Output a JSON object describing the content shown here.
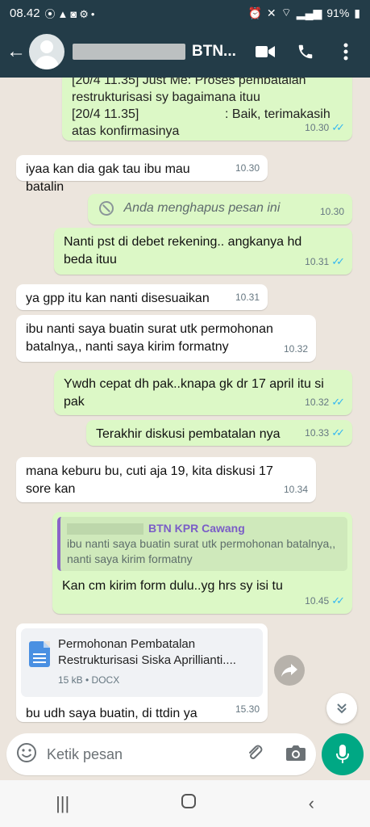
{
  "status_bar": {
    "time": "08.42",
    "battery": "91%"
  },
  "header": {
    "contact_suffix": "BTN...",
    "icons": [
      "back-arrow-icon",
      "avatar",
      "video-call-icon",
      "phone-icon",
      "more-vert-icon"
    ]
  },
  "messages": [
    {
      "dir": "out",
      "text": "[20/4 11.35] Just Me: Proses pembatalan restrukturisasi sy bagaimana ituu\n[20/4 11.35]                        : Baik, terimakasih atas konfirmasinya",
      "time": "10.30",
      "ticks": true
    },
    {
      "dir": "in",
      "text": "iyaa kan dia gak tau ibu mau batalin",
      "time": "10.30"
    },
    {
      "dir": "out",
      "text": "Anda menghapus pesan ini",
      "time": "10.30",
      "deleted": true
    },
    {
      "dir": "out",
      "text": "Nanti pst di debet rekening.. angkanya hd beda ituu",
      "time": "10.31",
      "ticks": true
    },
    {
      "dir": "in",
      "text": "ya gpp itu kan nanti disesuaikan",
      "time": "10.31"
    },
    {
      "dir": "in",
      "text": "ibu nanti saya buatin surat utk permohonan batalnya,, nanti saya kirim formatny",
      "time": "10.32"
    },
    {
      "dir": "out",
      "text": "Ywdh cepat dh pak..knapa gk dr 17 april itu si pak",
      "time": "10.32",
      "ticks": true
    },
    {
      "dir": "out",
      "text": "Terakhir diskusi pembatalan nya",
      "time": "10.33",
      "ticks": true
    },
    {
      "dir": "in",
      "text": "mana keburu bu, cuti aja 19, kita diskusi 17 sore kan",
      "time": "10.34"
    },
    {
      "dir": "out",
      "quote_name": "BTN KPR Cawang",
      "quote_text": "ibu nanti saya buatin surat utk permohonan batalnya,, nanti saya kirim formatny",
      "text": "Kan cm kirim form dulu..yg hrs sy isi tu",
      "time": "10.45",
      "ticks": true
    },
    {
      "dir": "in",
      "doc_title": "Permohonan Pembatalan Restrukturisasi Siska Aprillianti....",
      "doc_meta": "15 kB • DOCX",
      "text": "bu udh saya buatin, di ttdin ya",
      "time": "15.30"
    }
  ],
  "composer": {
    "placeholder": "Ketik pesan"
  }
}
